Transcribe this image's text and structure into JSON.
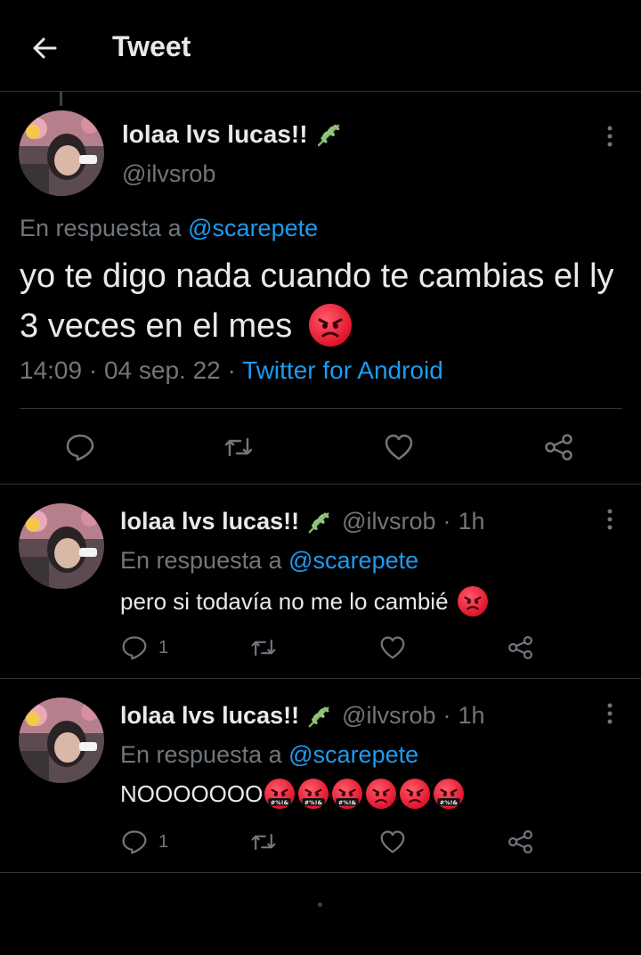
{
  "header": {
    "title": "Tweet"
  },
  "main_tweet": {
    "display_name": "lolaa lvs lucas!!",
    "handle": "@ilvsrob",
    "reply_prefix": "En respuesta a",
    "reply_to": "@scarepete",
    "text": "yo te digo nada cuando te cambias el ly 3 veces en el mes",
    "time": "14:09",
    "date": "04 sep. 22",
    "separator": "·",
    "source": "Twitter for Android"
  },
  "replies": [
    {
      "display_name": "lolaa lvs lucas!!",
      "handle": "@ilvsrob",
      "time_ago": "1h",
      "separator": "·",
      "reply_prefix": "En respuesta a",
      "reply_to": "@scarepete",
      "text": "pero si todavía no me lo cambié",
      "reply_count": "1"
    },
    {
      "display_name": "lolaa lvs lucas!!",
      "handle": "@ilvsrob",
      "time_ago": "1h",
      "separator": "·",
      "reply_prefix": "En respuesta a",
      "reply_to": "@scarepete",
      "text": "NOOOOOOO",
      "reply_count": "1",
      "cursing_label": "#%!&"
    }
  ],
  "colors": {
    "background": "#000000",
    "text": "#e7e9ea",
    "muted": "#71767b",
    "link": "#1d9bf0",
    "divider": "#2f3336",
    "angry_emoji": "#e0152c"
  }
}
